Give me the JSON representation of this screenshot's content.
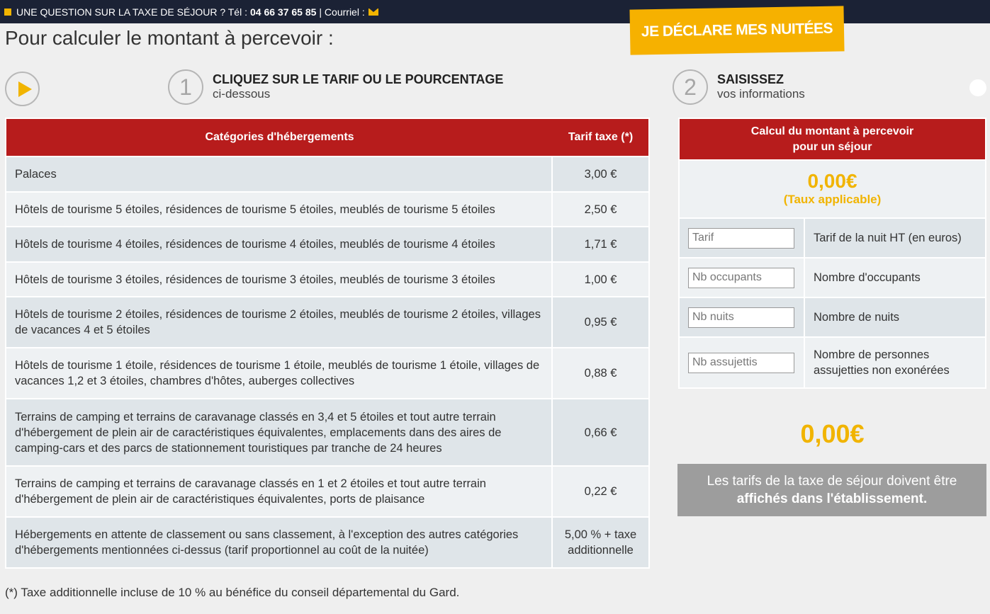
{
  "topbar": {
    "question": "UNE QUESTION SUR LA TAXE DE SÉJOUR ? Tél :",
    "phone": "04 66 37 65 85",
    "mail_label": "| Courriel :",
    "mail_icon": "envelope-icon",
    "accent": "#f1b400",
    "background": "#1b2235"
  },
  "page_title": "Pour calculer le montant à percevoir :",
  "cta_label": "JE DÉCLARE MES NUITÉES",
  "steps": [
    {
      "number": "1",
      "title": "CLIQUEZ SUR LE TARIF OU LE POURCENTAGE",
      "subtitle": "ci-dessous"
    },
    {
      "number": "2",
      "title": "SAISISSEZ",
      "subtitle": "vos informations"
    }
  ],
  "rates_table": {
    "header_category": "Catégories d'hébergements",
    "header_rate": "Tarif taxe (*)",
    "rows": [
      {
        "category": "Palaces",
        "rate": "3,00 €"
      },
      {
        "category": "Hôtels de tourisme 5 étoiles, résidences de tourisme 5 étoiles, meublés de tourisme 5 étoiles",
        "rate": "2,50 €"
      },
      {
        "category": "Hôtels de tourisme 4 étoiles, résidences de tourisme 4 étoiles, meublés de tourisme 4 étoiles",
        "rate": "1,71 €"
      },
      {
        "category": "Hôtels de tourisme 3 étoiles, résidences de tourisme 3 étoiles, meublés de tourisme 3 étoiles",
        "rate": "1,00 €"
      },
      {
        "category": "Hôtels de tourisme 2 étoiles, résidences de tourisme 2 étoiles, meublés de tourisme 2 étoiles, villages de vacances 4 et 5 étoiles",
        "rate": "0,95 €"
      },
      {
        "category": "Hôtels de tourisme 1 étoile, résidences de tourisme 1 étoile, meublés de tourisme 1 étoile, villages de vacances 1,2 et 3 étoiles, chambres d'hôtes, auberges collectives",
        "rate": "0,88 €"
      },
      {
        "category": "Terrains de camping et terrains de caravanage classés en 3,4 et 5 étoiles et tout autre terrain d'hébergement de plein air de caractéristiques équivalentes, emplacements dans des aires de camping-cars et des parcs de stationnement touristiques par tranche de 24 heures",
        "rate": "0,66 €"
      },
      {
        "category": "Terrains de camping et terrains de caravanage classés en 1 et 2 étoiles et tout autre terrain d'hébergement de plein air de caractéristiques équivalentes, ports de plaisance",
        "rate": "0,22 €"
      },
      {
        "category": "Hébergements en attente de classement ou sans classement, à l'exception des autres catégories d'hébergements mentionnées ci-dessus (tarif proportionnel au coût de la nuitée)",
        "rate": "5,00 % + taxe additionnelle"
      }
    ]
  },
  "calculator": {
    "header_line1": "Calcul du montant à percevoir",
    "header_line2": "pour un séjour",
    "rate_amount": "0,00€",
    "rate_label": "(Taux applicable)",
    "fields": [
      {
        "placeholder": "Tarif",
        "value": "",
        "label": "Tarif de la nuit HT (en euros)"
      },
      {
        "placeholder": "Nb occupants",
        "value": "",
        "label": "Nombre d'occupants"
      },
      {
        "placeholder": "Nb nuits",
        "value": "",
        "label": "Nombre de nuits"
      },
      {
        "placeholder": "Nb assujettis",
        "value": "",
        "label": "Nombre de personnes assujetties non exonérées"
      }
    ]
  },
  "total_amount": "0,00€",
  "notice": {
    "line1": "Les tarifs de la taxe de séjour doivent être",
    "line2": "affichés dans l'établissement."
  },
  "footnote": "(*) Taxe additionnelle incluse de 10 % au bénéfice du conseil départemental du Gard.",
  "colors": {
    "header_red": "#b71c1c",
    "accent_yellow": "#f1b400",
    "notice_grey": "#9d9d9d"
  }
}
